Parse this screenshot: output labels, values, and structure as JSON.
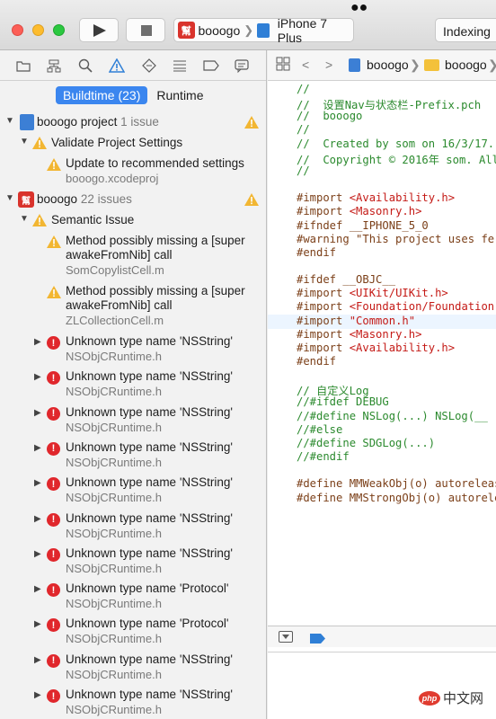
{
  "toolbar": {
    "app_icon_text": "幫",
    "scheme_name": "booogo",
    "device_name": "iPhone 7 Plus",
    "activity_text": "Indexing"
  },
  "navigator": {
    "segments": {
      "buildtime": "Buildtime (23)",
      "runtime": "Runtime"
    },
    "project1": {
      "name": "booogo project",
      "count": "1 issue"
    },
    "group1": {
      "label": "Validate Project Settings"
    },
    "item1": {
      "title": "Update to recommended settings",
      "file": "booogo.xcodeproj"
    },
    "project2": {
      "name": "booogo",
      "count": "22 issues"
    },
    "group2": {
      "label": "Semantic Issue"
    },
    "warnings": [
      {
        "line1": "Method possibly missing a [super",
        "line2": "awakeFromNib] call",
        "file": "SomCopylistCell.m"
      },
      {
        "line1": "Method possibly missing a [super",
        "line2": "awakeFromNib] call",
        "file": "ZLCollectionCell.m"
      }
    ],
    "errors": [
      {
        "title": "Unknown type name 'NSString'",
        "file": "NSObjCRuntime.h"
      },
      {
        "title": "Unknown type name 'NSString'",
        "file": "NSObjCRuntime.h"
      },
      {
        "title": "Unknown type name 'NSString'",
        "file": "NSObjCRuntime.h"
      },
      {
        "title": "Unknown type name 'NSString'",
        "file": "NSObjCRuntime.h"
      },
      {
        "title": "Unknown type name 'NSString'",
        "file": "NSObjCRuntime.h"
      },
      {
        "title": "Unknown type name 'NSString'",
        "file": "NSObjCRuntime.h"
      },
      {
        "title": "Unknown type name 'NSString'",
        "file": "NSObjCRuntime.h"
      },
      {
        "title": "Unknown type name 'Protocol'",
        "file": "NSObjCRuntime.h"
      },
      {
        "title": "Unknown type name 'Protocol'",
        "file": "NSObjCRuntime.h"
      },
      {
        "title": "Unknown type name 'NSString'",
        "file": "NSObjCRuntime.h"
      },
      {
        "title": "Unknown type name 'NSString'",
        "file": "NSObjCRuntime.h"
      }
    ]
  },
  "editor": {
    "jump_project": "booogo",
    "jump_folder": "booogo",
    "code_lines": [
      {
        "text": "//",
        "style": "com"
      },
      {
        "text": "//  设置Nav与状态栏-Prefix.pch",
        "style": "com"
      },
      {
        "text": "//  booogo",
        "style": "com"
      },
      {
        "text": "//",
        "style": "com"
      },
      {
        "text": "//  Created by som on 16/3/17.",
        "style": "com"
      },
      {
        "text": "//  Copyright © 2016年 som. All",
        "style": "com"
      },
      {
        "text": "//",
        "style": "com"
      },
      {
        "text": "",
        "style": "plain"
      },
      {
        "text": "#import <Availability.h>",
        "style": "pre"
      },
      {
        "text": "#import <Masonry.h>",
        "style": "pre"
      },
      {
        "text": "#ifndef __IPHONE_5_0",
        "style": "pre"
      },
      {
        "text": "#warning \"This project uses fe",
        "style": "pre"
      },
      {
        "text": "#endif",
        "style": "pre"
      },
      {
        "text": "",
        "style": "plain"
      },
      {
        "text": "#ifdef __OBJC__",
        "style": "pre"
      },
      {
        "text": "#import <UIKit/UIKit.h>",
        "style": "pre"
      },
      {
        "text": "#import <Foundation/Foundation",
        "style": "pre"
      },
      {
        "text": "#import \"Common.h\"",
        "style": "pre"
      },
      {
        "text": "#import <Masonry.h>",
        "style": "pre"
      },
      {
        "text": "#import <Availability.h>",
        "style": "pre"
      },
      {
        "text": "#endif",
        "style": "pre"
      },
      {
        "text": "",
        "style": "plain"
      },
      {
        "text": "// 自定义Log",
        "style": "com"
      },
      {
        "text": "//#ifdef DEBUG",
        "style": "com"
      },
      {
        "text": "//#define NSLog(...) NSLog(__",
        "style": "com"
      },
      {
        "text": "//#else",
        "style": "com"
      },
      {
        "text": "//#define SDGLog(...)",
        "style": "com"
      },
      {
        "text": "//#endif",
        "style": "com"
      },
      {
        "text": "",
        "style": "plain"
      },
      {
        "text": "#define MMWeakObj(o) autoreleas",
        "style": "pre"
      },
      {
        "text": "#define MMStrongObj(o) autoreleas",
        "style": "pre"
      }
    ],
    "highlighted_line": 17
  },
  "watermark": {
    "logo": "php",
    "text": "中文网"
  }
}
